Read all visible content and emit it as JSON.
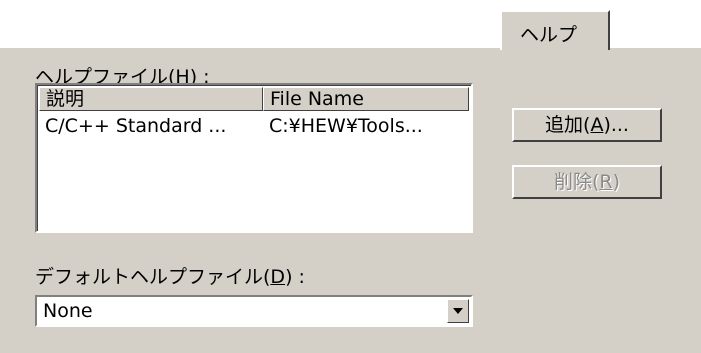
{
  "tab": {
    "label": "ヘルプ"
  },
  "help_files": {
    "label": "ヘルプファイル(",
    "mnemonic": "H",
    "label_suffix": ") :",
    "columns": [
      "説明",
      "File Name"
    ],
    "rows": [
      {
        "description": "C/C++ Standard ...",
        "file_name": "C:¥HEW¥Tools..."
      }
    ]
  },
  "buttons": {
    "add": {
      "prefix": "追加(",
      "mnemonic": "A",
      "suffix": ")..."
    },
    "remove": {
      "prefix": "削除(",
      "mnemonic": "R",
      "suffix": ")"
    }
  },
  "default_help": {
    "label": "デフォルトヘルプファイル(",
    "mnemonic": "D",
    "label_suffix": ") :",
    "value": "None"
  }
}
